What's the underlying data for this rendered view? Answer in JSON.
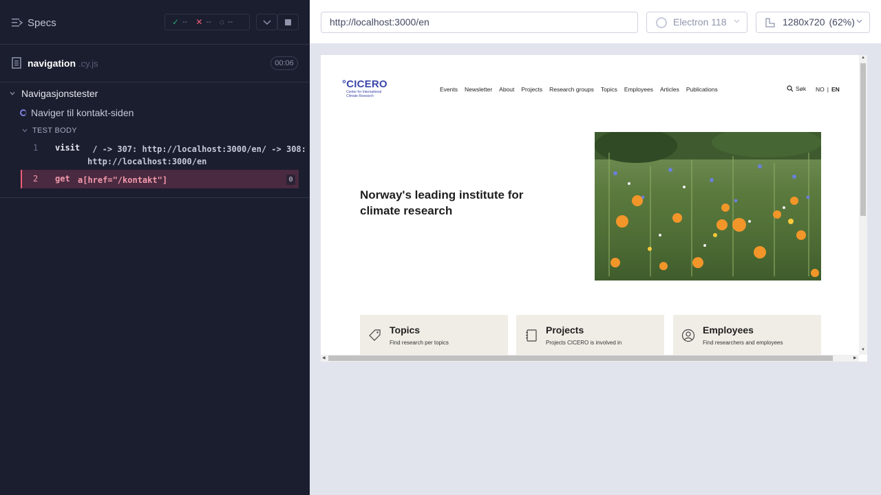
{
  "reporter": {
    "header": {
      "specs_label": "Specs",
      "stats": {
        "passed": "--",
        "failed": "--",
        "pending": "--"
      }
    },
    "spec": {
      "name": "navigation",
      "ext": ".cy.js",
      "duration": "00:06"
    },
    "suite": {
      "title": "Navigasjonstester",
      "test_title": "Naviger til kontakt-siden",
      "body_label": "TEST BODY",
      "commands": [
        {
          "num": "1",
          "name": "visit",
          "message": " / -> 307: http://localhost:3000/en/ -> 308:\nhttp://localhost:3000/en"
        },
        {
          "num": "2",
          "name": "get",
          "message": "a[href=\"/kontakt\"]",
          "badge": "0"
        }
      ]
    }
  },
  "topbar": {
    "url": "http://localhost:3000/en",
    "browser": "Electron 118",
    "viewport": "1280x720",
    "scale": "(62%)"
  },
  "site": {
    "logo": {
      "main": "°CICERO",
      "sub": "Center for International Climate Research"
    },
    "nav": [
      "Events",
      "Newsletter",
      "About",
      "Projects",
      "Research groups",
      "Topics",
      "Employees",
      "Articles",
      "Publications"
    ],
    "search_label": "Søk",
    "lang": {
      "no": "NO",
      "sep": "|",
      "en": "EN"
    },
    "hero_title": "Norway's leading institute for climate research",
    "cards": [
      {
        "title": "Topics",
        "desc": "Find research per topics",
        "icon": "tag-icon"
      },
      {
        "title": "Projects",
        "desc": "Projects CICERO is involved in",
        "icon": "notebook-icon"
      },
      {
        "title": "Employees",
        "desc": "Find researchers and employees",
        "icon": "person-icon"
      }
    ]
  },
  "colors": {
    "reporter_bg": "#1b1e2e",
    "pass": "#1fa971",
    "fail": "#f05d78",
    "brand": "#3a46a8"
  }
}
